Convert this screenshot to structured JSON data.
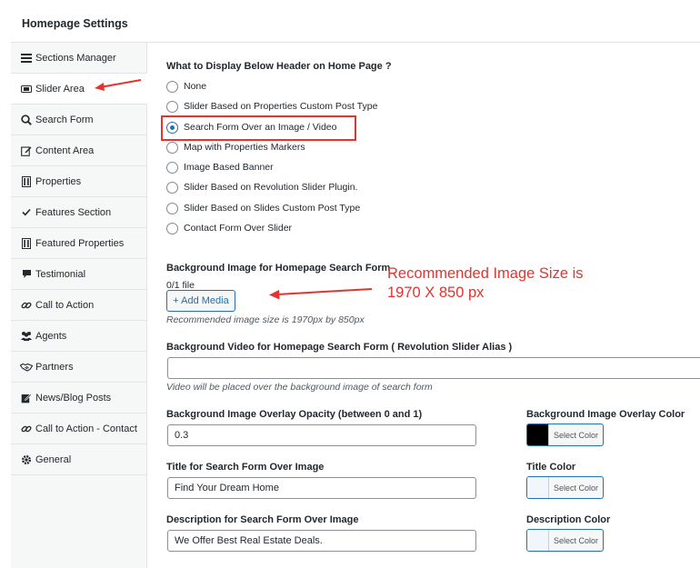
{
  "header": {
    "title": "Homepage Settings"
  },
  "sidebar": {
    "items": [
      {
        "label": "Sections Manager",
        "icon": "menu-lines-icon"
      },
      {
        "label": "Slider Area",
        "icon": "slider-icon"
      },
      {
        "label": "Search Form",
        "icon": "search-icon"
      },
      {
        "label": "Content Area",
        "icon": "edit-icon"
      },
      {
        "label": "Properties",
        "icon": "building-icon"
      },
      {
        "label": "Features Section",
        "icon": "checkmark-icon"
      },
      {
        "label": "Featured Properties",
        "icon": "building-icon"
      },
      {
        "label": "Testimonial",
        "icon": "speech-bubble-icon"
      },
      {
        "label": "Call to Action",
        "icon": "link-icon"
      },
      {
        "label": "Agents",
        "icon": "users-icon"
      },
      {
        "label": "Partners",
        "icon": "handshake-icon"
      },
      {
        "label": "News/Blog Posts",
        "icon": "edit-note-icon"
      },
      {
        "label": "Call to Action - Contact",
        "icon": "link-icon"
      },
      {
        "label": "General",
        "icon": "gear-icon"
      }
    ]
  },
  "display_below": {
    "title": "What to Display Below Header on Home Page ?",
    "options": [
      {
        "label": "None",
        "checked": false
      },
      {
        "label": "Slider Based on Properties Custom Post Type",
        "checked": false
      },
      {
        "label": "Search Form Over an Image / Video",
        "checked": true
      },
      {
        "label": "Map with Properties Markers",
        "checked": false
      },
      {
        "label": "Image Based Banner",
        "checked": false
      },
      {
        "label": "Slider Based on Revolution Slider Plugin.",
        "checked": false
      },
      {
        "label": "Slider Based on Slides Custom Post Type",
        "checked": false
      },
      {
        "label": "Contact Form Over Slider",
        "checked": false
      }
    ]
  },
  "bg_image": {
    "label": "Background Image for Homepage Search Form",
    "file_count": "0/1 file",
    "add_media": "+ Add Media",
    "hint": "Recommended image size is 1970px by 850px"
  },
  "annotation": {
    "line1": "Recommended Image Size is",
    "line2": "1970 X 850 px"
  },
  "bg_video": {
    "label": "Background Video for Homepage Search Form ( Revolution Slider Alias )",
    "value": "",
    "hint": "Video will be placed over the background image of search form"
  },
  "overlay_opacity": {
    "label": "Background Image Overlay Opacity (between 0 and 1)",
    "value": "0.3"
  },
  "overlay_color": {
    "label": "Background Image Overlay Color",
    "button": "Select Color",
    "color": "#000000"
  },
  "title_field": {
    "label": "Title for Search Form Over Image",
    "value": "Find Your Dream Home"
  },
  "title_color": {
    "label": "Title Color",
    "button": "Select Color",
    "color": "#f0f6fc"
  },
  "desc_field": {
    "label": "Description for Search Form Over Image",
    "value": "We Offer Best Real Estate Deals."
  },
  "desc_color": {
    "label": "Description Color",
    "button": "Select Color",
    "color": "#f0f6fc"
  },
  "colors": {
    "accent": "#2271b1",
    "annotation": "#e3342f"
  }
}
